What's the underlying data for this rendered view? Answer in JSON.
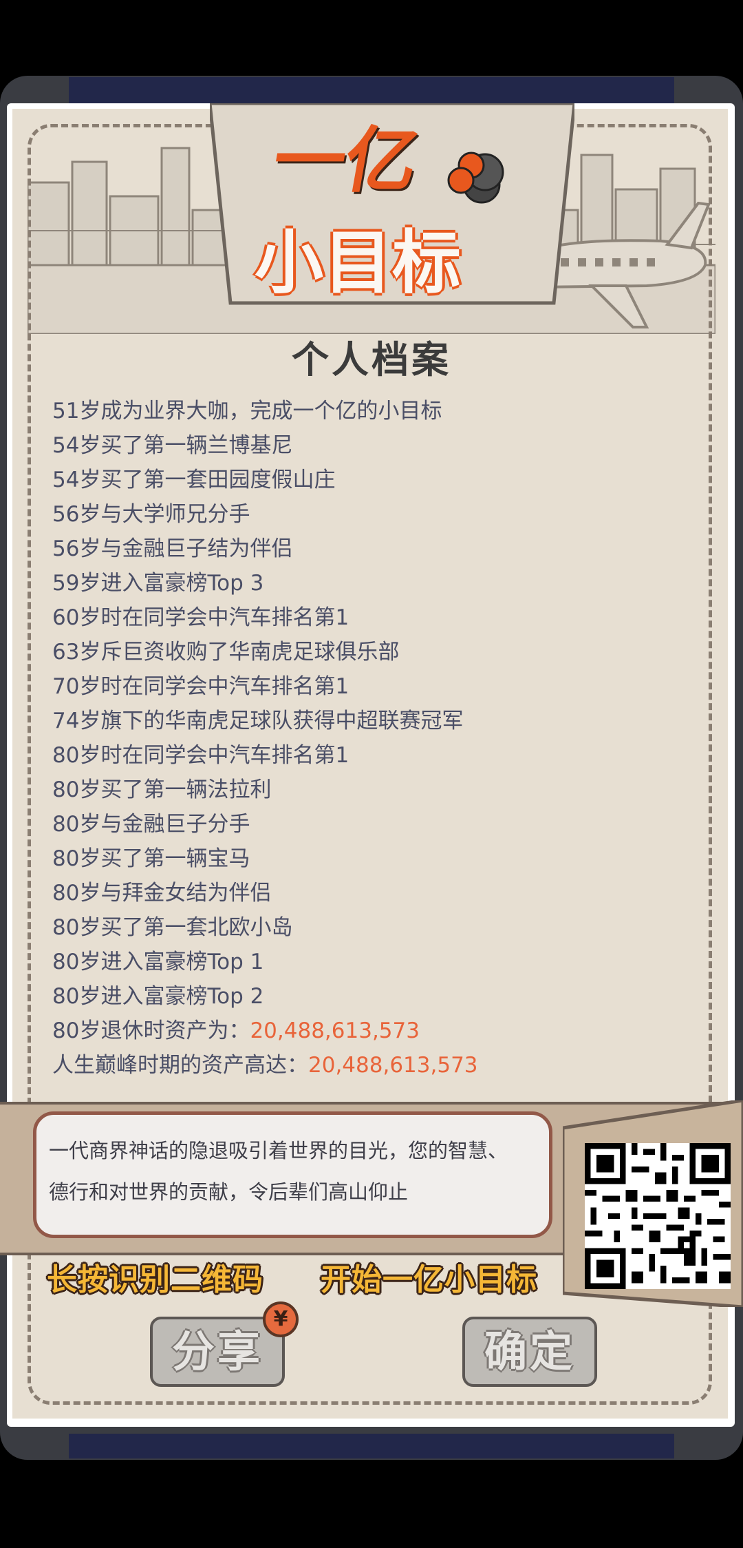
{
  "logo": {
    "line1": "一亿",
    "line2": "小目标"
  },
  "page_title": "个人档案",
  "records": [
    {
      "text": "51岁成为业界大咖，完成一个亿的小目标"
    },
    {
      "text": "54岁买了第一辆兰博基尼"
    },
    {
      "text": "54岁买了第一套田园度假山庄"
    },
    {
      "text": "56岁与大学师兄分手"
    },
    {
      "text": "56岁与金融巨子结为伴侣"
    },
    {
      "text": "59岁进入富豪榜Top 3"
    },
    {
      "text": "60岁时在同学会中汽车排名第1"
    },
    {
      "text": "63岁斥巨资收购了华南虎足球俱乐部"
    },
    {
      "text": "70岁时在同学会中汽车排名第1"
    },
    {
      "text": "74岁旗下的华南虎足球队获得中超联赛冠军"
    },
    {
      "text": "80岁时在同学会中汽车排名第1"
    },
    {
      "text": "80岁买了第一辆法拉利"
    },
    {
      "text": "80岁与金融巨子分手"
    },
    {
      "text": "80岁买了第一辆宝马"
    },
    {
      "text": "80岁与拜金女结为伴侣"
    },
    {
      "text": "80岁买了第一套北欧小岛"
    },
    {
      "text": "80岁进入富豪榜Top 1"
    },
    {
      "text": "80岁进入富豪榜Top 2"
    }
  ],
  "retire_assets": {
    "label": "80岁退休时资产为：",
    "value": "20,488,613,573"
  },
  "peak_assets": {
    "label": "人生巅峰时期的资产高达：",
    "value": "20,488,613,573"
  },
  "message": {
    "line1": "一代商界神话的隐退吸引着世界的目光，您的智慧、",
    "line2": "德行和对世界的贡献，令后辈们高山仰止"
  },
  "cta": {
    "scan": "长按识别二维码",
    "start": "开始一亿小目标"
  },
  "buttons": {
    "share": "分享",
    "confirm": "确定",
    "coin_symbol": "¥"
  },
  "colors": {
    "accent": "#e8643a",
    "background": "#e7dfd2",
    "cta": "#f5b736"
  }
}
